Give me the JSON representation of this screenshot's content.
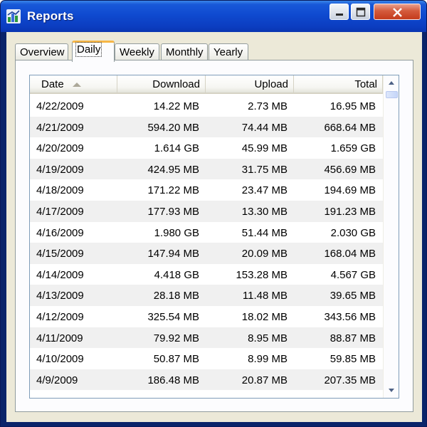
{
  "window": {
    "title": "Reports",
    "icon": "reports-chart-icon",
    "titlebar_color": "#0f4ad0"
  },
  "tabs": [
    {
      "label": "Overview",
      "active": false
    },
    {
      "label": "Daily",
      "active": true
    },
    {
      "label": "Weekly",
      "active": false
    },
    {
      "label": "Monthly",
      "active": false
    },
    {
      "label": "Yearly",
      "active": false
    }
  ],
  "table": {
    "columns": [
      "Date",
      "Download",
      "Upload",
      "Total"
    ],
    "sort_column": "Date",
    "sort_direction": "ascending-indicator",
    "rows": [
      {
        "date": "4/22/2009",
        "download": "14.22 MB",
        "upload": "2.73 MB",
        "total": "16.95 MB"
      },
      {
        "date": "4/21/2009",
        "download": "594.20 MB",
        "upload": "74.44 MB",
        "total": "668.64 MB"
      },
      {
        "date": "4/20/2009",
        "download": "1.614 GB",
        "upload": "45.99 MB",
        "total": "1.659 GB"
      },
      {
        "date": "4/19/2009",
        "download": "424.95 MB",
        "upload": "31.75 MB",
        "total": "456.69 MB"
      },
      {
        "date": "4/18/2009",
        "download": "171.22 MB",
        "upload": "23.47 MB",
        "total": "194.69 MB"
      },
      {
        "date": "4/17/2009",
        "download": "177.93 MB",
        "upload": "13.30 MB",
        "total": "191.23 MB"
      },
      {
        "date": "4/16/2009",
        "download": "1.980 GB",
        "upload": "51.44 MB",
        "total": "2.030 GB"
      },
      {
        "date": "4/15/2009",
        "download": "147.94 MB",
        "upload": "20.09 MB",
        "total": "168.04 MB"
      },
      {
        "date": "4/14/2009",
        "download": "4.418 GB",
        "upload": "153.28 MB",
        "total": "4.567 GB"
      },
      {
        "date": "4/13/2009",
        "download": "28.18 MB",
        "upload": "11.48 MB",
        "total": "39.65 MB"
      },
      {
        "date": "4/12/2009",
        "download": "325.54 MB",
        "upload": "18.02 MB",
        "total": "343.56 MB"
      },
      {
        "date": "4/11/2009",
        "download": "79.92 MB",
        "upload": "8.95 MB",
        "total": "88.87 MB"
      },
      {
        "date": "4/10/2009",
        "download": "50.87 MB",
        "upload": "8.99 MB",
        "total": "59.85 MB"
      },
      {
        "date": "4/9/2009",
        "download": "186.48 MB",
        "upload": "20.87 MB",
        "total": "207.35 MB"
      }
    ]
  },
  "colors": {
    "accent_tab": "#f7b646",
    "alt_row": "#f0f0f0",
    "dialog_bg": "#ece9d8"
  }
}
